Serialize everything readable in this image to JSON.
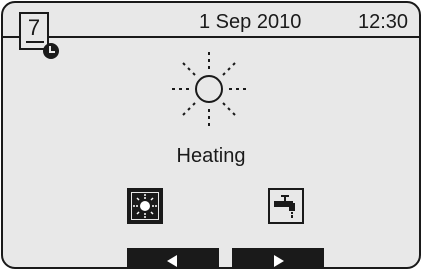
{
  "header": {
    "menu_number": "7",
    "date": "1 Sep 2010",
    "time": "12:30"
  },
  "main": {
    "mode_label": "Heating"
  },
  "icons": {
    "clock_badge": "clock-icon",
    "main_symbol": "sun-icon",
    "heating_mode": "sun-icon",
    "hot_water_mode": "tap-icon",
    "prev": "triangle-left-icon",
    "next": "triangle-right-icon"
  },
  "colors": {
    "screen_background": "#e8e8e8",
    "foreground": "#1a1a1a"
  }
}
